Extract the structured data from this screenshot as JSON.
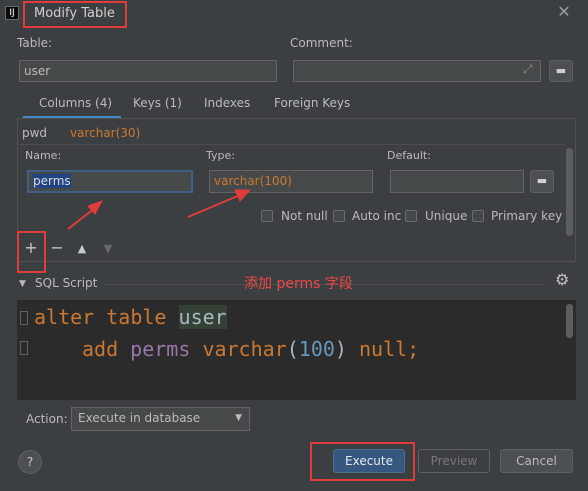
{
  "window": {
    "title": "Modify Table",
    "app_icon_glyph": "IJ"
  },
  "form": {
    "table_label": "Table:",
    "table_value": "user",
    "comment_label": "Comment:",
    "comment_value": "",
    "expand_glyph": "⤢",
    "note_glyph": "▬"
  },
  "tabs": [
    {
      "label": "Columns (4)",
      "active": true
    },
    {
      "label": "Keys (1)",
      "active": false
    },
    {
      "label": "Indexes",
      "active": false
    },
    {
      "label": "Foreign Keys",
      "active": false
    }
  ],
  "columns": {
    "existing_row": {
      "name": "pwd",
      "type": "varchar(30)"
    },
    "name_label": "Name:",
    "type_label": "Type:",
    "default_label": "Default:",
    "name_value": "perms",
    "type_value": "varchar(100)",
    "default_value": "",
    "checkboxes": [
      {
        "label": "Not null",
        "checked": false
      },
      {
        "label": "Auto inc",
        "checked": false
      },
      {
        "label": "Unique",
        "checked": false
      },
      {
        "label": "Primary key",
        "checked": false
      }
    ],
    "toolbar": {
      "add": "+",
      "remove": "−",
      "up": "▲",
      "down": "▼"
    }
  },
  "sql": {
    "section_label": "SQL Script",
    "line1": {
      "kw": "alter",
      "kw2": "table",
      "id": "user"
    },
    "line2": {
      "kw": "add",
      "col": "perms",
      "type": "varchar",
      "num": "100",
      "rest_open": "(",
      "rest_close": ")",
      "kw3": "null",
      "end": ";"
    }
  },
  "annotation": "添加 perms 字段",
  "action": {
    "label": "Action:",
    "selected": "Execute in database"
  },
  "buttons": {
    "help": "?",
    "execute": "Execute",
    "preview": "Preview",
    "cancel": "Cancel"
  },
  "colors": {
    "accent": "#4a88c7",
    "annotation_red": "#e03c3c",
    "keyword": "#cc7832",
    "number": "#6897bb"
  }
}
